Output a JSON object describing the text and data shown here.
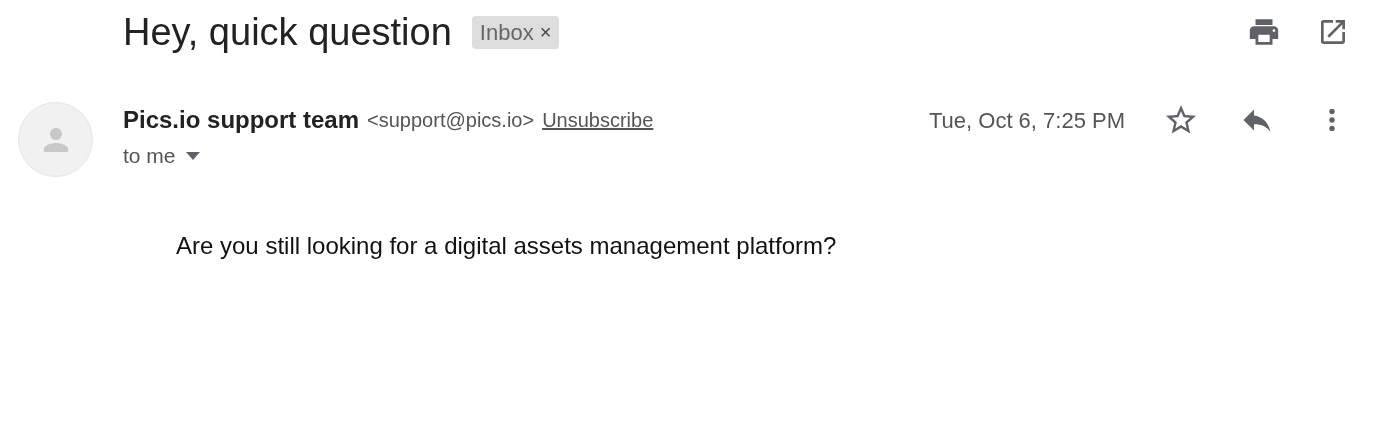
{
  "subject": "Hey, quick question",
  "label": {
    "text": "Inbox",
    "remove": "×"
  },
  "sender": {
    "name": "Pics.io support team",
    "email": "<support@pics.io>",
    "unsubscribe": "Unsubscribe"
  },
  "recipient": "to me",
  "date": "Tue, Oct 6, 7:25 PM",
  "starred": false,
  "body": "Are you still looking for a digital assets management platform?"
}
